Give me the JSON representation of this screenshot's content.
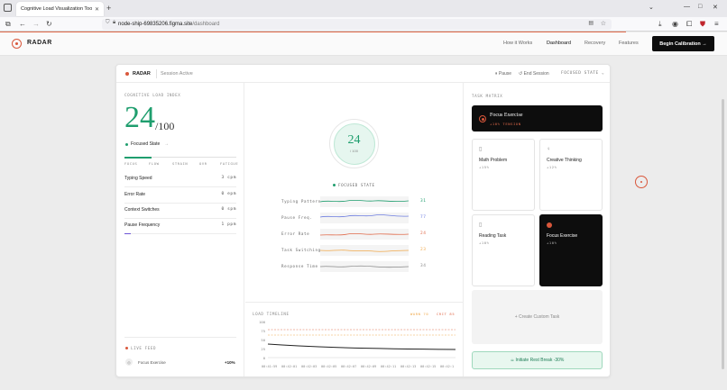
{
  "browser": {
    "tab_title": "Cognitive Load Visualization Tool",
    "url_host": "node-ship-69835206.figma.site",
    "url_path": "/dashboard"
  },
  "site": {
    "brand": "RADAR",
    "nav": [
      "How it Works",
      "Dashboard",
      "Recovery",
      "Features"
    ],
    "active_nav": "Dashboard",
    "cta": "Begin Calibration →"
  },
  "card_header": {
    "brand": "RADAR",
    "session": "Session Active",
    "pause": "Pause",
    "end_session": "End Session",
    "state": "FOCUSED STATE"
  },
  "cognitive": {
    "label": "COGNITIVE LOAD INDEX",
    "value": "24",
    "max": "/100",
    "state": "Focused State",
    "state_arrow": "→",
    "scale": [
      "FOCUS",
      "FLOW",
      "STRAIN",
      "OVR",
      "FATIGUE"
    ],
    "metrics": [
      {
        "name": "Typing Speed",
        "value": "3 cpm",
        "fill": 0
      },
      {
        "name": "Error Rate",
        "value": "0 epm",
        "fill": 0
      },
      {
        "name": "Context Switches",
        "value": "0 spm",
        "fill": 0
      },
      {
        "name": "Pause Frequency",
        "value": "1 ppm",
        "fill": 0.06
      }
    ]
  },
  "live_feed": {
    "label": "LIVE FEED",
    "item_name": "Focus Exercise",
    "item_value": "+10%"
  },
  "gauge": {
    "value": "24",
    "sub": "/ 100",
    "state": "FOCUSED STATE"
  },
  "sparklines": [
    {
      "name": "Typing Pattern",
      "value": "31",
      "color": "#1f9e6e"
    },
    {
      "name": "Pause Freq.",
      "value": "77",
      "color": "#6e7ee0"
    },
    {
      "name": "Error Rate",
      "value": "24",
      "color": "#e06a4a"
    },
    {
      "name": "Task Switching",
      "value": "23",
      "color": "#f0a84a"
    },
    {
      "name": "Response Time",
      "value": "34",
      "color": "#888888"
    }
  ],
  "timeline": {
    "title": "LOAD TIMELINE",
    "legend_warn": "WARN 70",
    "legend_crit": "CRIT 85",
    "y_ticks": [
      "100",
      "75",
      "50",
      "25",
      "0"
    ],
    "x_ticks": [
      "00:41:59",
      "00:42:01",
      "00:42:03",
      "00:42:05",
      "00:42:07",
      "00:42:09",
      "00:42:11",
      "00:42:13",
      "00:42:15",
      "00:42:1"
    ]
  },
  "tasks": {
    "title": "TASK MATRIX",
    "banner_name": "Focus Exercise",
    "banner_sub": "+10% TENSION",
    "tiles": [
      {
        "name": "Math Problem",
        "sub": "+15%",
        "icon": "📄"
      },
      {
        "name": "Creative Thinking",
        "sub": "+12%",
        "icon": "💡"
      },
      {
        "name": "Reading Task",
        "sub": "+10%",
        "icon": "📄"
      },
      {
        "name": "Focus Exercise",
        "sub": "+10%",
        "icon": "●"
      }
    ],
    "custom": "+ Create Custom Task",
    "rest": "Initiate Rest Break -30%"
  },
  "colors": {
    "accent": "#d9573b",
    "focus_green": "#1f9e6e",
    "dark": "#0d0d0d"
  }
}
